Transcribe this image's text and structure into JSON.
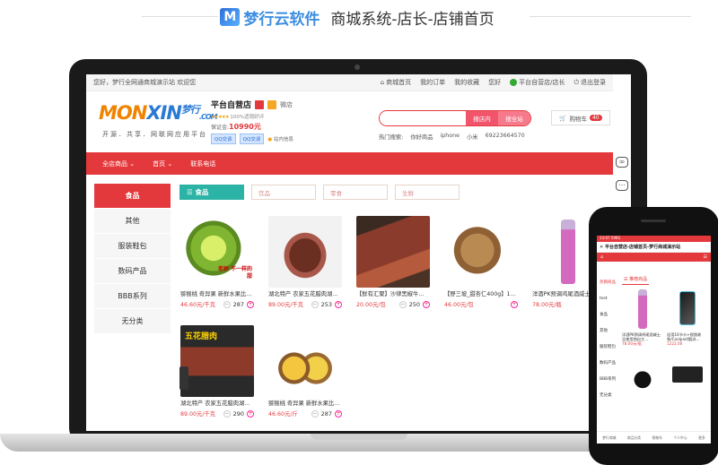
{
  "header": {
    "brand": "梦行云软件",
    "subtitle": "商城系统-店长-店铺首页"
  },
  "topbar": {
    "welcome": "您好，梦行全网通商城演示站 欢迎您",
    "links": [
      "商城首页",
      "我的订单",
      "我的收藏"
    ],
    "greeting": "您好",
    "store_admin": "平台自营店/店长",
    "logout": "退出登录"
  },
  "logo": {
    "part1": "MON",
    "part2": "XIN",
    "mark": "梦行",
    "suffix": ".COM",
    "slogan": "开源．共享．网联网应用平台"
  },
  "shop": {
    "name": "平台自营店",
    "badge_label": "微店",
    "rating_text": "100%适销好评",
    "bond_label": "保证金:",
    "bond_value": "10990元",
    "qq1": "QQ交谈",
    "qq2": "QQ交谈",
    "message": "站内信息"
  },
  "search": {
    "placeholder": "",
    "btn_shop": "搜店内",
    "btn_all": "搜全站"
  },
  "cart": {
    "label": "购物车",
    "count": "40"
  },
  "hot": {
    "label": "热门搜索:",
    "terms": [
      "你好商品",
      "iphone",
      "小米",
      "69223664570"
    ]
  },
  "nav": {
    "items": [
      "全店商品",
      "首页",
      "联系电话"
    ]
  },
  "categories": [
    "食品",
    "其他",
    "服装鞋包",
    "数码产品",
    "BBB系列",
    "无分类"
  ],
  "tabs": [
    "食品",
    "饮品",
    "零食",
    "生鲜"
  ],
  "products": [
    {
      "name": "猕猴桃 奇异果 新鲜水果比…",
      "price": "46.60元/千克",
      "qty": "287"
    },
    {
      "name": "湖北特产 农家五花腊肉湖…",
      "price": "89.00元/千克",
      "qty": "253"
    },
    {
      "name": "【鲜有汇聚】沙律黑椒牛…",
      "price": "20.00元/包",
      "qty": "250"
    },
    {
      "name": "【野三坡_甜杏仁400g】1…",
      "price": "46.00元/包",
      "qty": "0"
    },
    {
      "name": "洋酒PK预调鸡尾酒威士…",
      "price": "78.00元/瓶",
      "qty": ""
    },
    {
      "name": "湖北特产 农家五花腊肉湖…",
      "price": "89.00元/千克",
      "qty": "290"
    },
    {
      "name": "猕猴桃 奇异果 新鲜水果比…",
      "price": "46.60元/斤",
      "qty": "287"
    }
  ],
  "image_text": {
    "kiwi_tag": "老树 不一样的 甜",
    "pork_tag": "五花腊肉"
  },
  "phone": {
    "status": "13:07 59KS",
    "title": "平台自营店-店铺首页-梦行商城演示站",
    "tab": "推荐商品",
    "categories": [
      "热销商品",
      "test",
      "食品",
      "其他",
      "服装鞋包",
      "数码产品",
      "BBB系列",
      "无分类"
    ],
    "products": [
      {
        "name": "洋酒PK预调鸡尾酒威士忌使用独自主…",
        "price": "78.00元/瓶"
      },
      {
        "name": "适用16节卡+视频故装/Coolpad/酷派…",
        "price": "1222.00"
      }
    ],
    "bottom": [
      "梦行商城",
      "商品分类",
      "购物车",
      "个人中心",
      "更多"
    ]
  },
  "colors": {
    "accent": "#e4393c",
    "teal": "#2bb3a5",
    "brand_blue": "#3d8ee0"
  }
}
